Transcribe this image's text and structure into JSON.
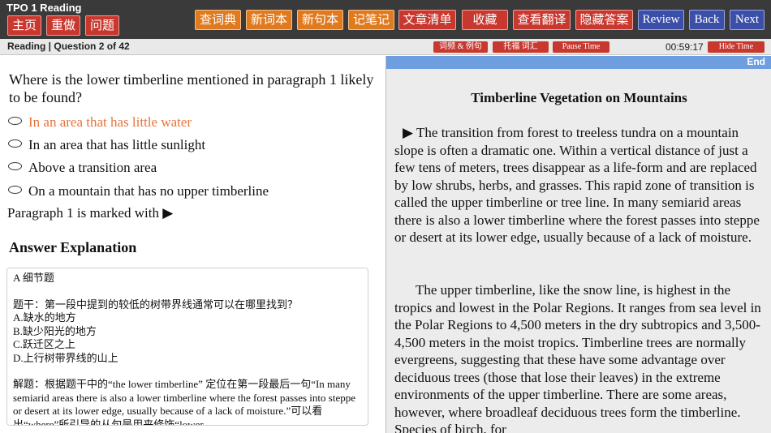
{
  "app": {
    "title": "TPO 1 Reading"
  },
  "toolbar": {
    "home": "主页",
    "redo": "重做",
    "issues": "问题",
    "dictionary": "查词典",
    "new_words": "新词本",
    "new_sentences": "新句本",
    "notes": "记笔记",
    "article_list": "文章清单",
    "favorite": "收藏",
    "view_translation": "查看翻译",
    "hide_answer": "隐藏答案",
    "review": "Review",
    "back": "Back",
    "next": "Next"
  },
  "subbar": {
    "progress": "Reading | Question 2 of 42",
    "word_freq": "词频 & 例句",
    "toefl_vocab": "托福 词汇",
    "pause_time": "Pause Time",
    "timer": "00:59:17",
    "hide_time": "Hide Time"
  },
  "question": {
    "text": "Where is the lower timberline mentioned in paragraph 1 likely to be found?",
    "options": [
      "In an area that has little water",
      "In an area that has little sunlight",
      "Above a transition area",
      "On a mountain that has no upper timberline"
    ],
    "selected_index": 0,
    "paragraph_note": "Paragraph 1 is marked with ▶"
  },
  "explanation": {
    "title": "Answer Explanation",
    "lines": [
      "A 细节题",
      "",
      "题干：第一段中提到的较低的树带界线通常可以在哪里找到？",
      "A.缺水的地方",
      "B.缺少阳光的地方",
      "C.跃迁区之上",
      "D.上行树带界线的山上",
      "",
      "解题：根据题干中的“the lower timberline” 定位在第一段最后一句“In many semiarid areas there is also a lower timberline where the forest passes into steppe or desert at its lower edge, usually because of a lack of moisture.”可以看出“where”所引导的从句是用来修饰“lower"
    ]
  },
  "passage": {
    "end_label": "End",
    "title": "Timberline Vegetation on Mountains",
    "paragraphs": [
      "▶ The transition from forest to treeless tundra on a mountain slope is often a dramatic one. Within a vertical distance of just a few tens of meters, trees disappear as a life-form and are replaced by low shrubs, herbs, and grasses. This rapid zone of transition is called the upper timberline or tree line. In many semiarid areas there is also a lower timberline where the forest passes into steppe or desert at its lower edge, usually because of a lack of moisture.",
      "The upper timberline, like the snow line, is highest in the tropics and lowest in the Polar Regions. It ranges from sea level in the Polar Regions to 4,500 meters in the dry subtropics and 3,500-4,500 meters in the moist tropics. Timberline trees are normally evergreens, suggesting that these have some advantage over deciduous trees (those that lose their leaves) in the extreme environments of the upper timberline. There are some areas, however, where broadleaf deciduous trees form the timberline. Species of birch, for"
    ]
  },
  "colors": {
    "topbar": "#3a3a3a",
    "red_button": "#c9382f",
    "orange_button": "#e07a1f",
    "blue_button": "#3b4fa8",
    "selected_option": "#e8733a",
    "passage_header": "#6d9fe0"
  }
}
